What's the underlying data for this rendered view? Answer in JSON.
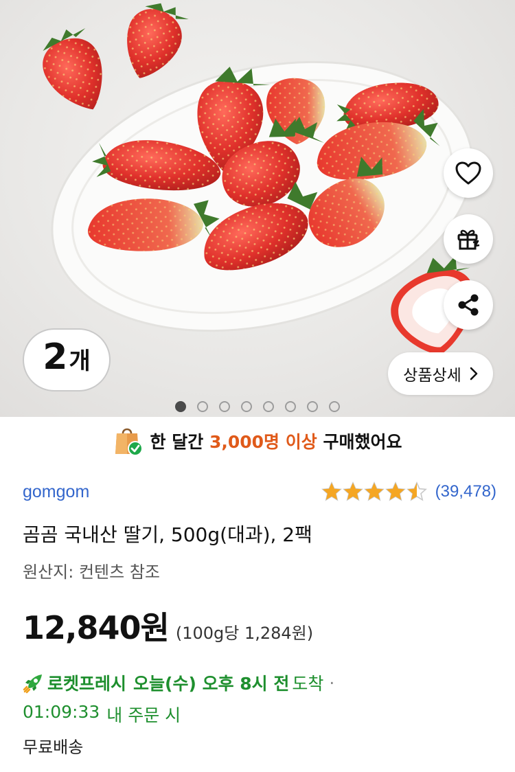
{
  "hero": {
    "quantity_number": "2",
    "quantity_unit": "개",
    "detail_button_label": "상품상세",
    "image_count": 8,
    "active_image_index": 0
  },
  "purchase_banner": {
    "prefix": "한 달간",
    "highlight": "3,000명 이상",
    "suffix": "구매했어요"
  },
  "seller": {
    "name": "gomgom"
  },
  "rating": {
    "score_out_of_5": 4.5,
    "review_count": "(39,478)"
  },
  "product": {
    "title": "곰곰 국내산 딸기, 500g(대과), 2팩",
    "origin": "원산지: 컨텐츠 참조"
  },
  "price": {
    "amount": "12,840원",
    "unit_price": "(100g당 1,284원)"
  },
  "delivery": {
    "brand": "로켓프레시",
    "eta": "오늘(수) 오후 8시 전",
    "eta_tail": "도착",
    "separator": "·",
    "countdown_time": "01:09:33",
    "countdown_suffix": "내 주문 시",
    "shipping": "무료배송"
  },
  "colors": {
    "star": "#f5a623",
    "link": "#3366cc",
    "rocket_green": "#1e8f2e",
    "highlight_orange": "#e05a1a"
  }
}
